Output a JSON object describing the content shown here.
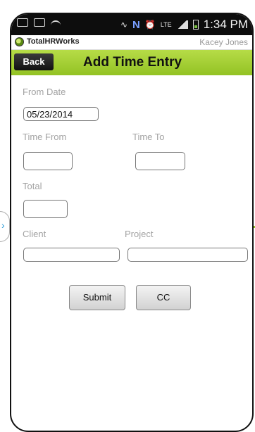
{
  "status_bar": {
    "time": "1:34 PM"
  },
  "app": {
    "name": "TotalHRWorks",
    "user": "Kacey Jones"
  },
  "header": {
    "back_label": "Back",
    "title": "Add Time Entry"
  },
  "form": {
    "from_date_label": "From Date",
    "from_date_value": "05/23/2014",
    "time_from_label": "Time From",
    "time_from_value": "",
    "time_to_label": "Time To",
    "time_to_value": "",
    "total_label": "Total",
    "total_value": "",
    "client_label": "Client",
    "client_value": "",
    "project_label": "Project",
    "project_value": ""
  },
  "actions": {
    "submit_label": "Submit",
    "cc_label": "CC"
  },
  "colors": {
    "accent_green": "#93c224",
    "status_bar_bg": "#0d0d0d"
  },
  "icons": {
    "status_left": [
      "image-icon",
      "message-icon",
      "wifi-hotspot-icon"
    ],
    "status_right": [
      "vibrate-icon",
      "nfc-icon",
      "alarm-icon",
      "lte-icon",
      "signal-icon",
      "battery-icon"
    ],
    "side_panel": "chevron-right-icon"
  }
}
